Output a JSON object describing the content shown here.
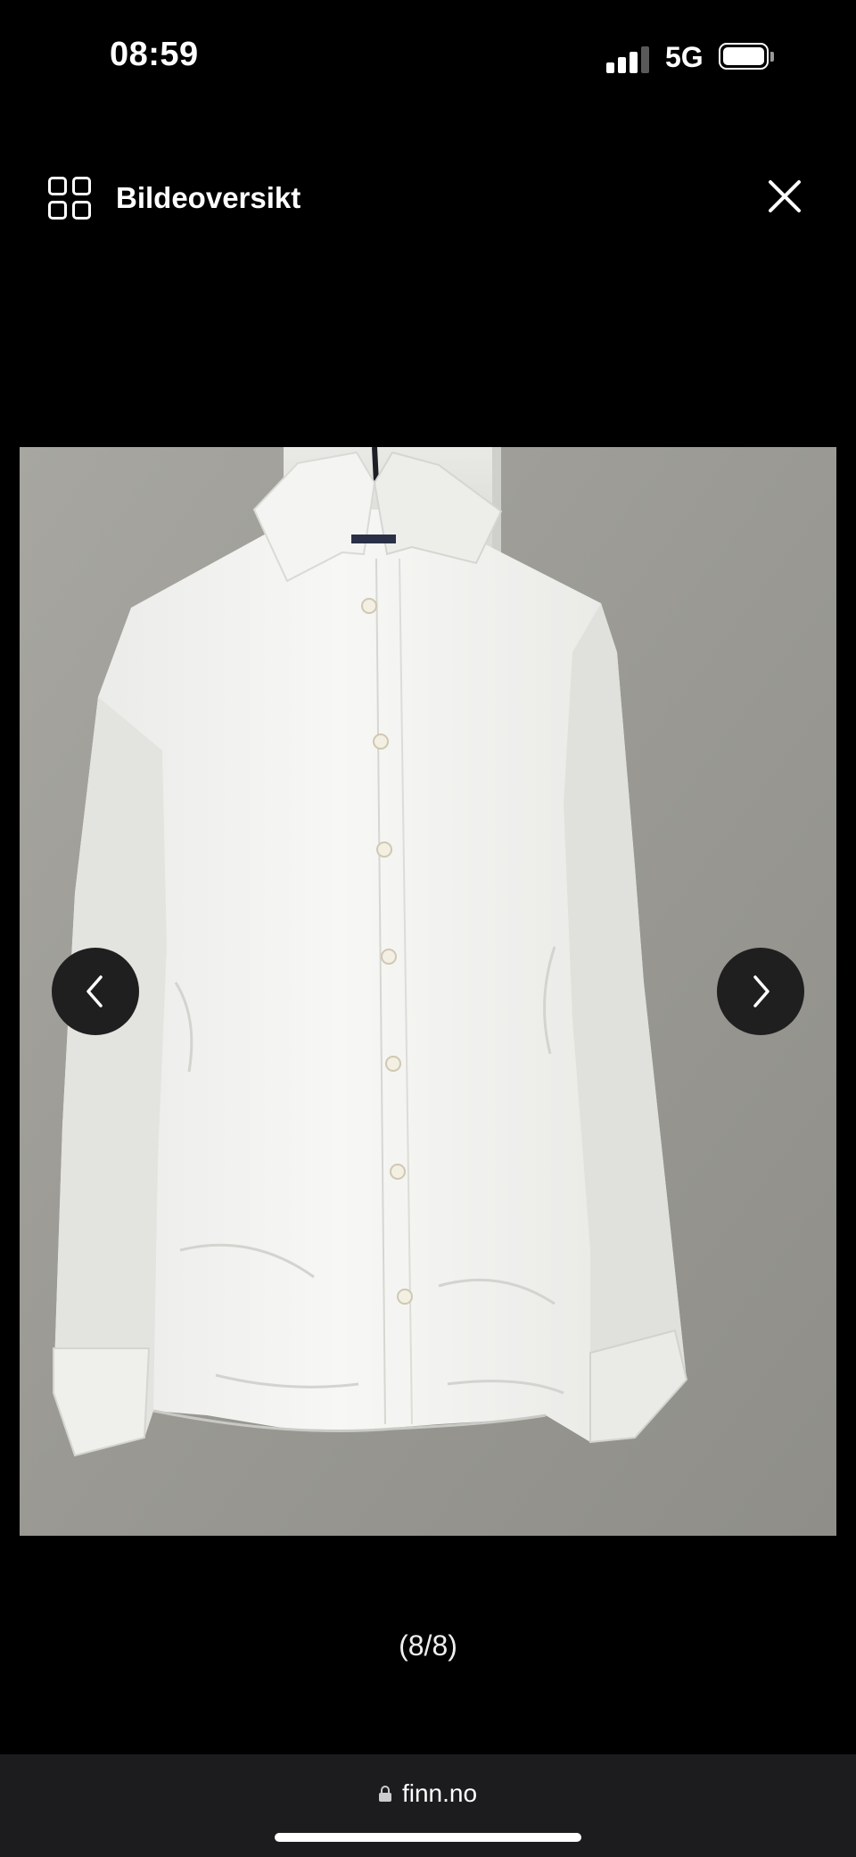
{
  "status_bar": {
    "time": "08:59",
    "network": "5G",
    "signal_bars": 3,
    "battery_level": 0.9
  },
  "header": {
    "overview_label": "Bildeoversikt",
    "overview_icon": "grid-icon",
    "close_icon": "close-icon"
  },
  "image_viewer": {
    "prev_icon": "chevron-left-icon",
    "next_icon": "chevron-right-icon",
    "counter": "(8/8)"
  },
  "browser": {
    "url": "finn.no",
    "lock_icon": "lock-icon"
  }
}
